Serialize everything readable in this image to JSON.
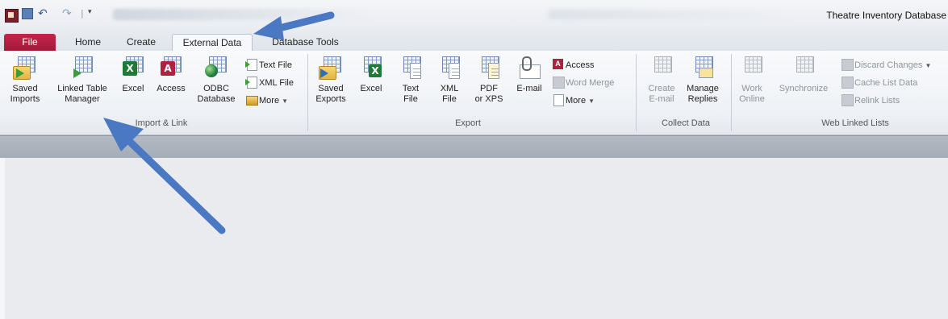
{
  "window": {
    "title": "Theatre Inventory Database"
  },
  "tabs": [
    {
      "label": "File"
    },
    {
      "label": "Home"
    },
    {
      "label": "Create"
    },
    {
      "label": "External Data"
    },
    {
      "label": "Database Tools"
    }
  ],
  "ribbon": {
    "import_link": {
      "label": "Import & Link",
      "saved_imports": [
        "Saved",
        "Imports"
      ],
      "linked_table_manager": [
        "Linked Table",
        "Manager"
      ],
      "excel": "Excel",
      "access": "Access",
      "odbc": [
        "ODBC",
        "Database"
      ],
      "text_file": "Text File",
      "xml_file": "XML File",
      "more": "More"
    },
    "export": {
      "label": "Export",
      "saved_exports": [
        "Saved",
        "Exports"
      ],
      "excel": "Excel",
      "text_file": [
        "Text",
        "File"
      ],
      "xml_file": [
        "XML",
        "File"
      ],
      "pdf_xps": [
        "PDF",
        "or XPS"
      ],
      "email": "E-mail",
      "access": "Access",
      "word_merge": "Word Merge",
      "more": "More"
    },
    "collect_data": {
      "label": "Collect Data",
      "create_email": [
        "Create",
        "E-mail"
      ],
      "manage_replies": [
        "Manage",
        "Replies"
      ]
    },
    "web_linked_lists": {
      "label": "Web Linked Lists",
      "work_online": [
        "Work",
        "Online"
      ],
      "synchronize": "Synchronize",
      "discard_changes": "Discard Changes",
      "cache_list_data": "Cache List Data",
      "relink_lists": "Relink Lists"
    }
  },
  "colors": {
    "file_tab": "#b61e42",
    "annotation_arrow": "#4a78c2"
  },
  "icons": [
    "app-icon",
    "save-icon",
    "undo-icon",
    "redo-icon",
    "arrow-annotation"
  ]
}
